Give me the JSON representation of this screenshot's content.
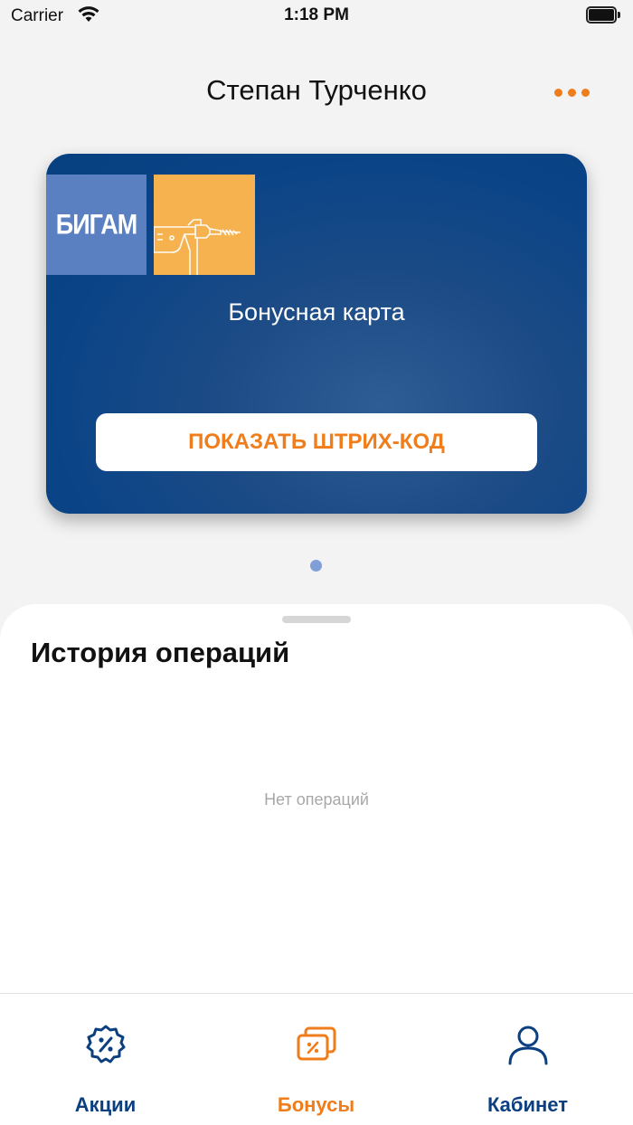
{
  "status_bar": {
    "carrier": "Carrier",
    "time": "1:18 PM"
  },
  "header": {
    "title": "Степан Турченко",
    "menu_icon": "more-horizontal-icon"
  },
  "card": {
    "logo_text": "БИГАМ",
    "title": "Бонусная карта",
    "barcode_button": "ПОКАЗАТЬ ШТРИХ-КОД"
  },
  "pager": {
    "count": 1,
    "current": 1
  },
  "history": {
    "title": "История операций",
    "empty_text": "Нет операций"
  },
  "tabs": [
    {
      "label": "Акции",
      "icon": "discount-badge-icon",
      "active": false
    },
    {
      "label": "Бонусы",
      "icon": "bonus-cards-icon",
      "active": true
    },
    {
      "label": "Кабинет",
      "icon": "user-icon",
      "active": false
    }
  ],
  "colors": {
    "accent": "#f07d1b",
    "brand_blue": "#0b3f7f",
    "card_blue": "#0a4487",
    "logo_tile": "#5a80c2",
    "drill_tile": "#f6b24f"
  }
}
